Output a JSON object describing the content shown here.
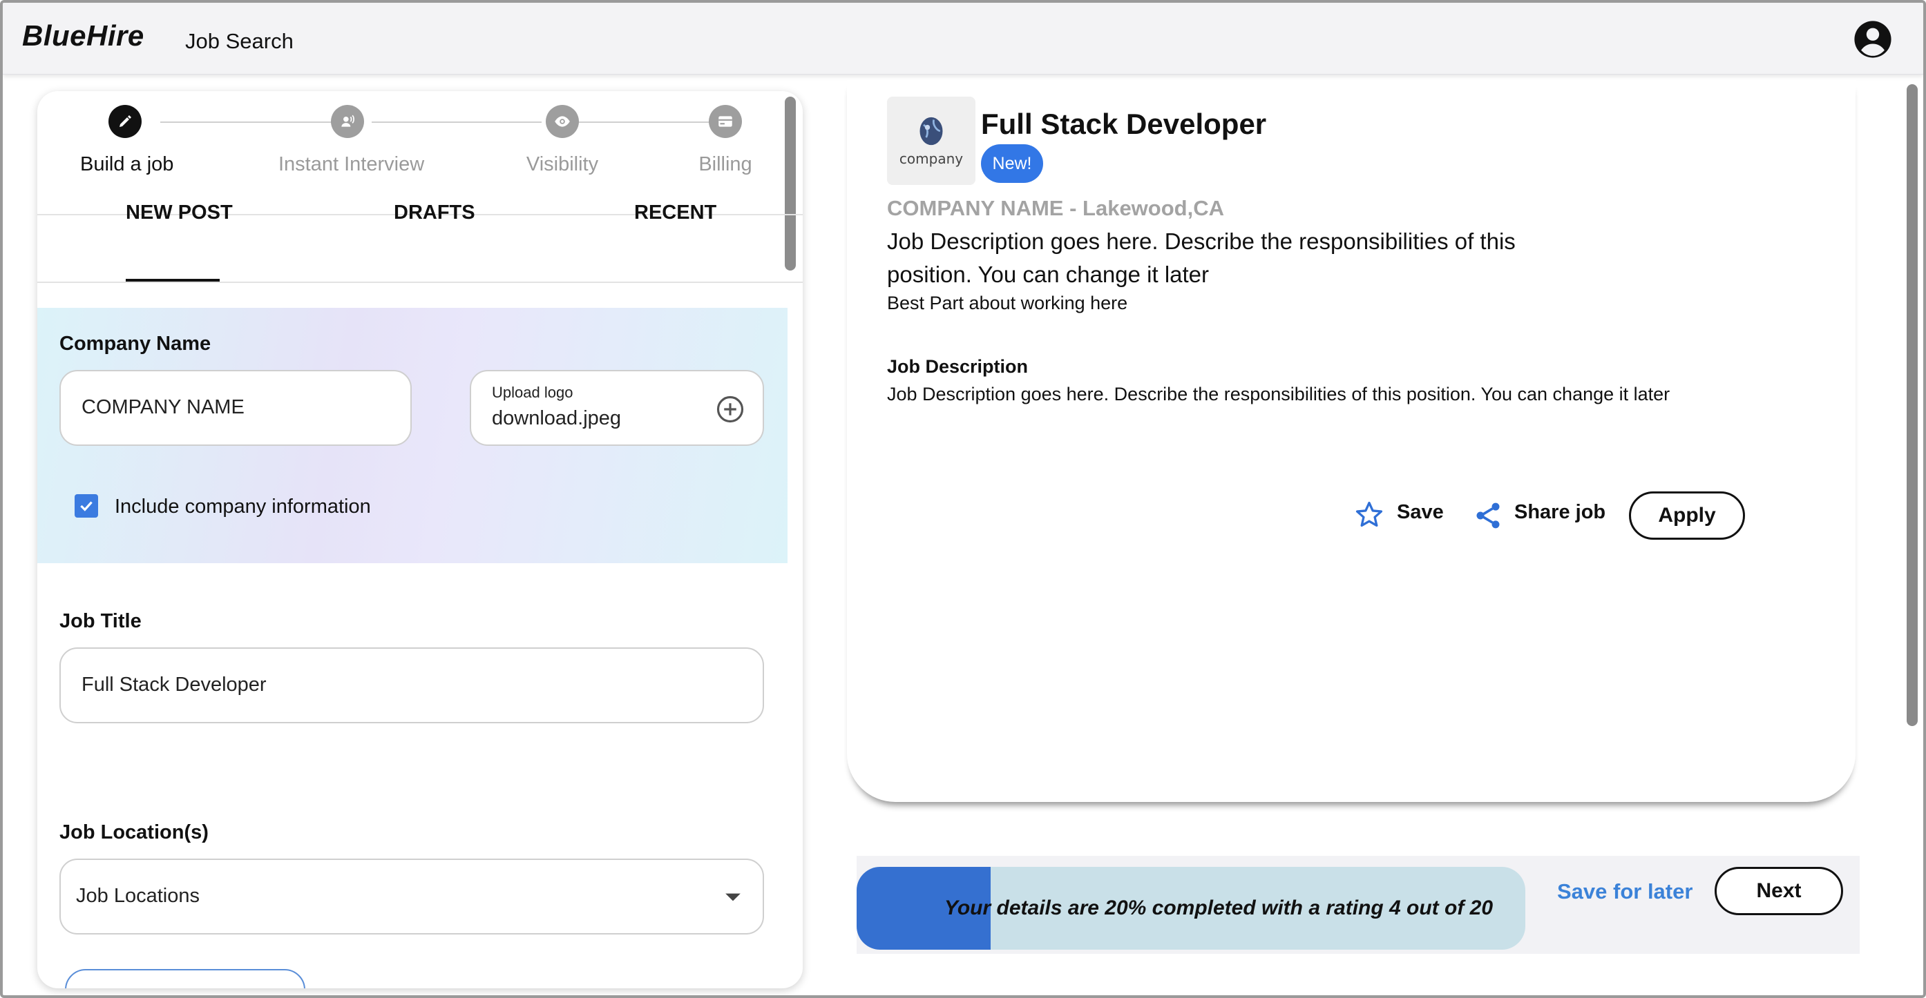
{
  "header": {
    "brand": "BlueHire",
    "nav_link": "Job Search",
    "account_icon": "account-circle-icon"
  },
  "stepper": {
    "steps": [
      {
        "label": "Build a job",
        "icon": "pencil-icon",
        "active": true
      },
      {
        "label": "Instant Interview",
        "icon": "speaking-person-icon",
        "active": false
      },
      {
        "label": "Visibility",
        "icon": "eye-icon",
        "active": false
      },
      {
        "label": "Billing",
        "icon": "credit-card-icon",
        "active": false
      }
    ]
  },
  "tabs": {
    "items": [
      "NEW POST",
      "DRAFTS",
      "RECENT"
    ],
    "selected": "NEW POST"
  },
  "form": {
    "company_label": "Company Name",
    "company_value": "COMPANY NAME",
    "upload_label": "Upload logo",
    "upload_value": "download.jpeg",
    "include_company_label": "Include company information",
    "include_company_checked": true,
    "job_title_label": "Job Title",
    "job_title_value": "Full Stack Developer",
    "job_location_label": "Job Location(s)",
    "job_location_value": "Job Locations"
  },
  "preview": {
    "logo_text": "company",
    "job_title": "Full Stack Developer",
    "badge": "New!",
    "company_line": "COMPANY NAME - Lakewood,CA",
    "description_main": "Job Description goes here. Describe the responsibilities of this position. You can change it later",
    "best_part": "Best Part about working here",
    "jd_heading": "Job Description",
    "jd_body": "Job Description goes here. Describe the responsibilities of this position. You can change it later",
    "actions": {
      "save": "Save",
      "share": "Share job",
      "apply": "Apply"
    }
  },
  "progress": {
    "text": "Your details are 20% completed with a rating 4 out of 20",
    "percent": 20,
    "save_later": "Save for later",
    "next": "Next"
  },
  "colors": {
    "accent": "#3277e6",
    "progress_fill": "#3570d0",
    "link": "#3b82d8"
  }
}
